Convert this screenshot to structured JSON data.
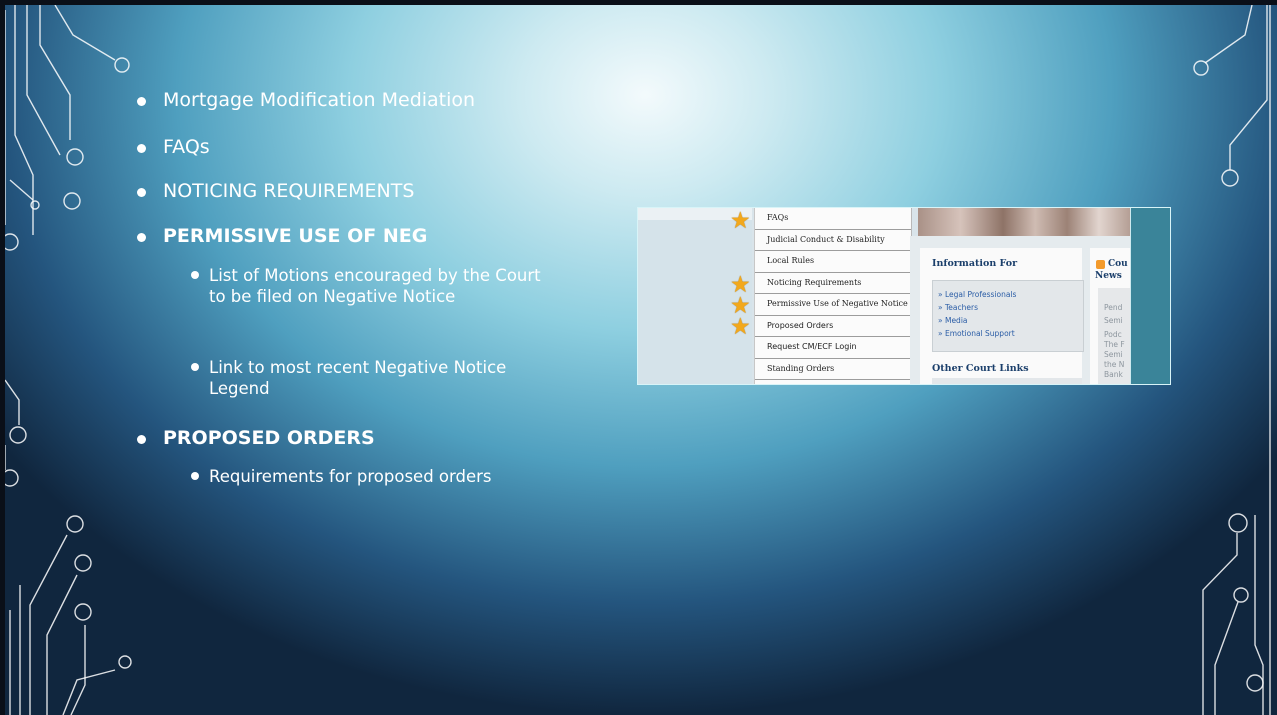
{
  "bullets": {
    "b1": "Mortgage Modification Mediation",
    "b2": "FAQs",
    "b3": "NOTICING REQUIREMENTS",
    "b4": "PERMISSIVE USE OF NEG",
    "b4_sub1": "List of Motions encouraged by the Court to be filed on Negative Notice",
    "b4_sub2": "Link to most recent Negative Notice Legend",
    "b5": "PROPOSED ORDERS",
    "b5_sub1": "Requirements for proposed orders"
  },
  "screenshot": {
    "menu": [
      "FAQs",
      "Judicial Conduct & Disability",
      "Local Rules",
      "Noticing Requirements",
      "Permissive Use of Negative Notice",
      "Proposed Orders",
      "Request CM/ECF Login",
      "Standing Orders"
    ],
    "info_title": "Information For",
    "links": [
      "» Legal Professionals",
      "» Teachers",
      "» Media",
      "» Emotional Support"
    ],
    "other_title": "Other Court Links",
    "news_title_1": "Cou",
    "news_title_2": "News",
    "news_lines": [
      "Pend",
      "Semi",
      "Podc",
      "The F",
      "Semi",
      "the N",
      "Bank"
    ]
  },
  "colors": {
    "star": "#f2a81c",
    "link": "#2b5da6",
    "heading": "#1b3f6b"
  },
  "icons": [
    "star-icon",
    "rss-icon",
    "bullet-dot-icon"
  ]
}
